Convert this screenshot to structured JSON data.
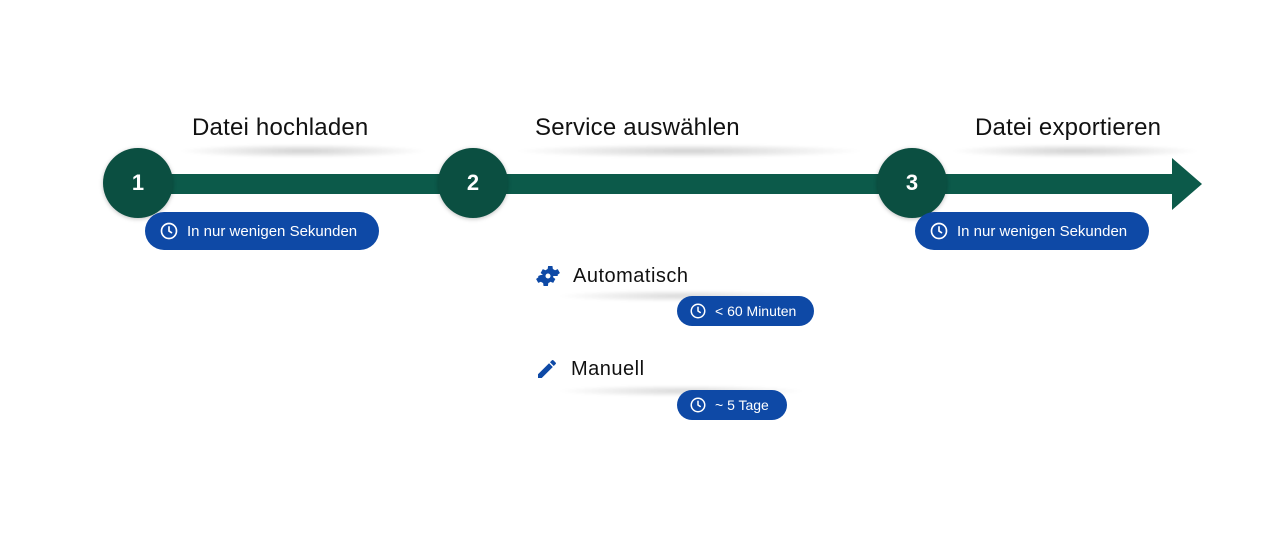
{
  "steps": [
    {
      "num": "1",
      "title": "Datei hochladen",
      "badge": "In nur wenigen Sekunden"
    },
    {
      "num": "2",
      "title": "Service auswählen"
    },
    {
      "num": "3",
      "title": "Datei exportieren",
      "badge": "In nur wenigen Sekunden"
    }
  ],
  "options": [
    {
      "label": "Automatisch",
      "time": "< 60 Minuten"
    },
    {
      "label": "Manuell",
      "time": "~ 5 Tage"
    }
  ],
  "colors": {
    "green": "#0c5a4a",
    "blue": "#0e49a6"
  }
}
